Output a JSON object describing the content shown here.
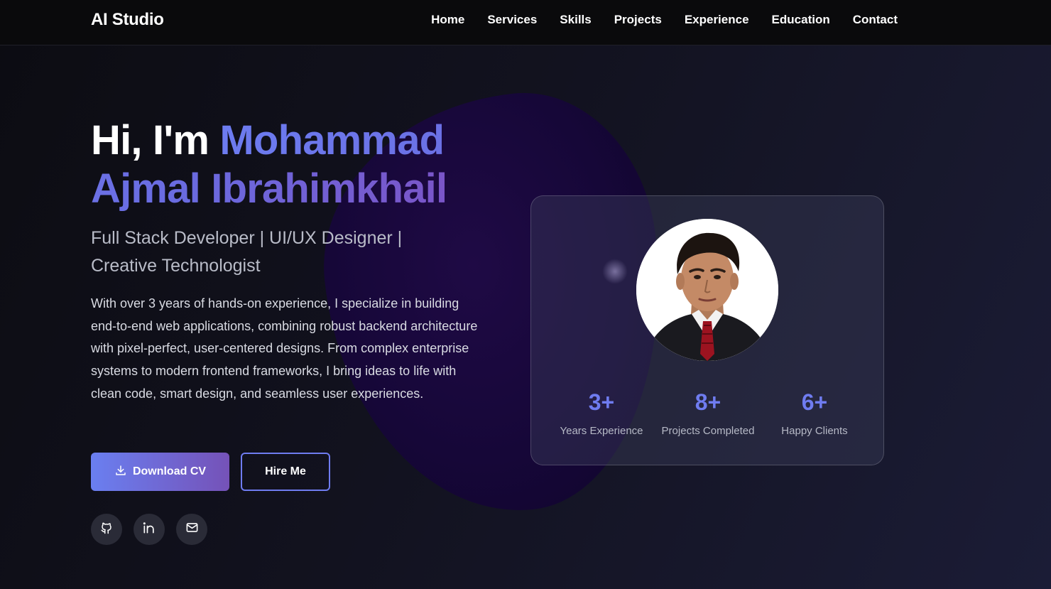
{
  "nav": {
    "brand": "AI Studio",
    "links": [
      "Home",
      "Services",
      "Skills",
      "Projects",
      "Experience",
      "Education",
      "Contact"
    ]
  },
  "hero": {
    "greeting": "Hi, I'm ",
    "name": "Mohammad Ajmal Ibrahimkhail",
    "subtitle": "Full Stack Developer | UI/UX Designer | Creative Technologist",
    "intro": "With over 3 years of hands-on experience, I specialize in building end-to-end web applications, combining robust backend architecture with pixel-perfect, user-centered designs. From complex enterprise systems to modern frontend frameworks, I bring ideas to life with clean code, smart design, and seamless user experiences.",
    "download_label": "Download CV",
    "hire_label": "Hire Me"
  },
  "socials": [
    {
      "icon": "github-icon"
    },
    {
      "icon": "linkedin-icon"
    },
    {
      "icon": "mail-icon"
    }
  ],
  "stats": [
    {
      "value": "3+",
      "label": "Years Experience"
    },
    {
      "value": "8+",
      "label": "Projects Completed"
    },
    {
      "value": "6+",
      "label": "Happy Clients"
    }
  ],
  "colors": {
    "accent": "#6f7cf0",
    "accent_purple": "#7552b8",
    "background": "#12121f",
    "navbar": "#0a0a0c"
  }
}
